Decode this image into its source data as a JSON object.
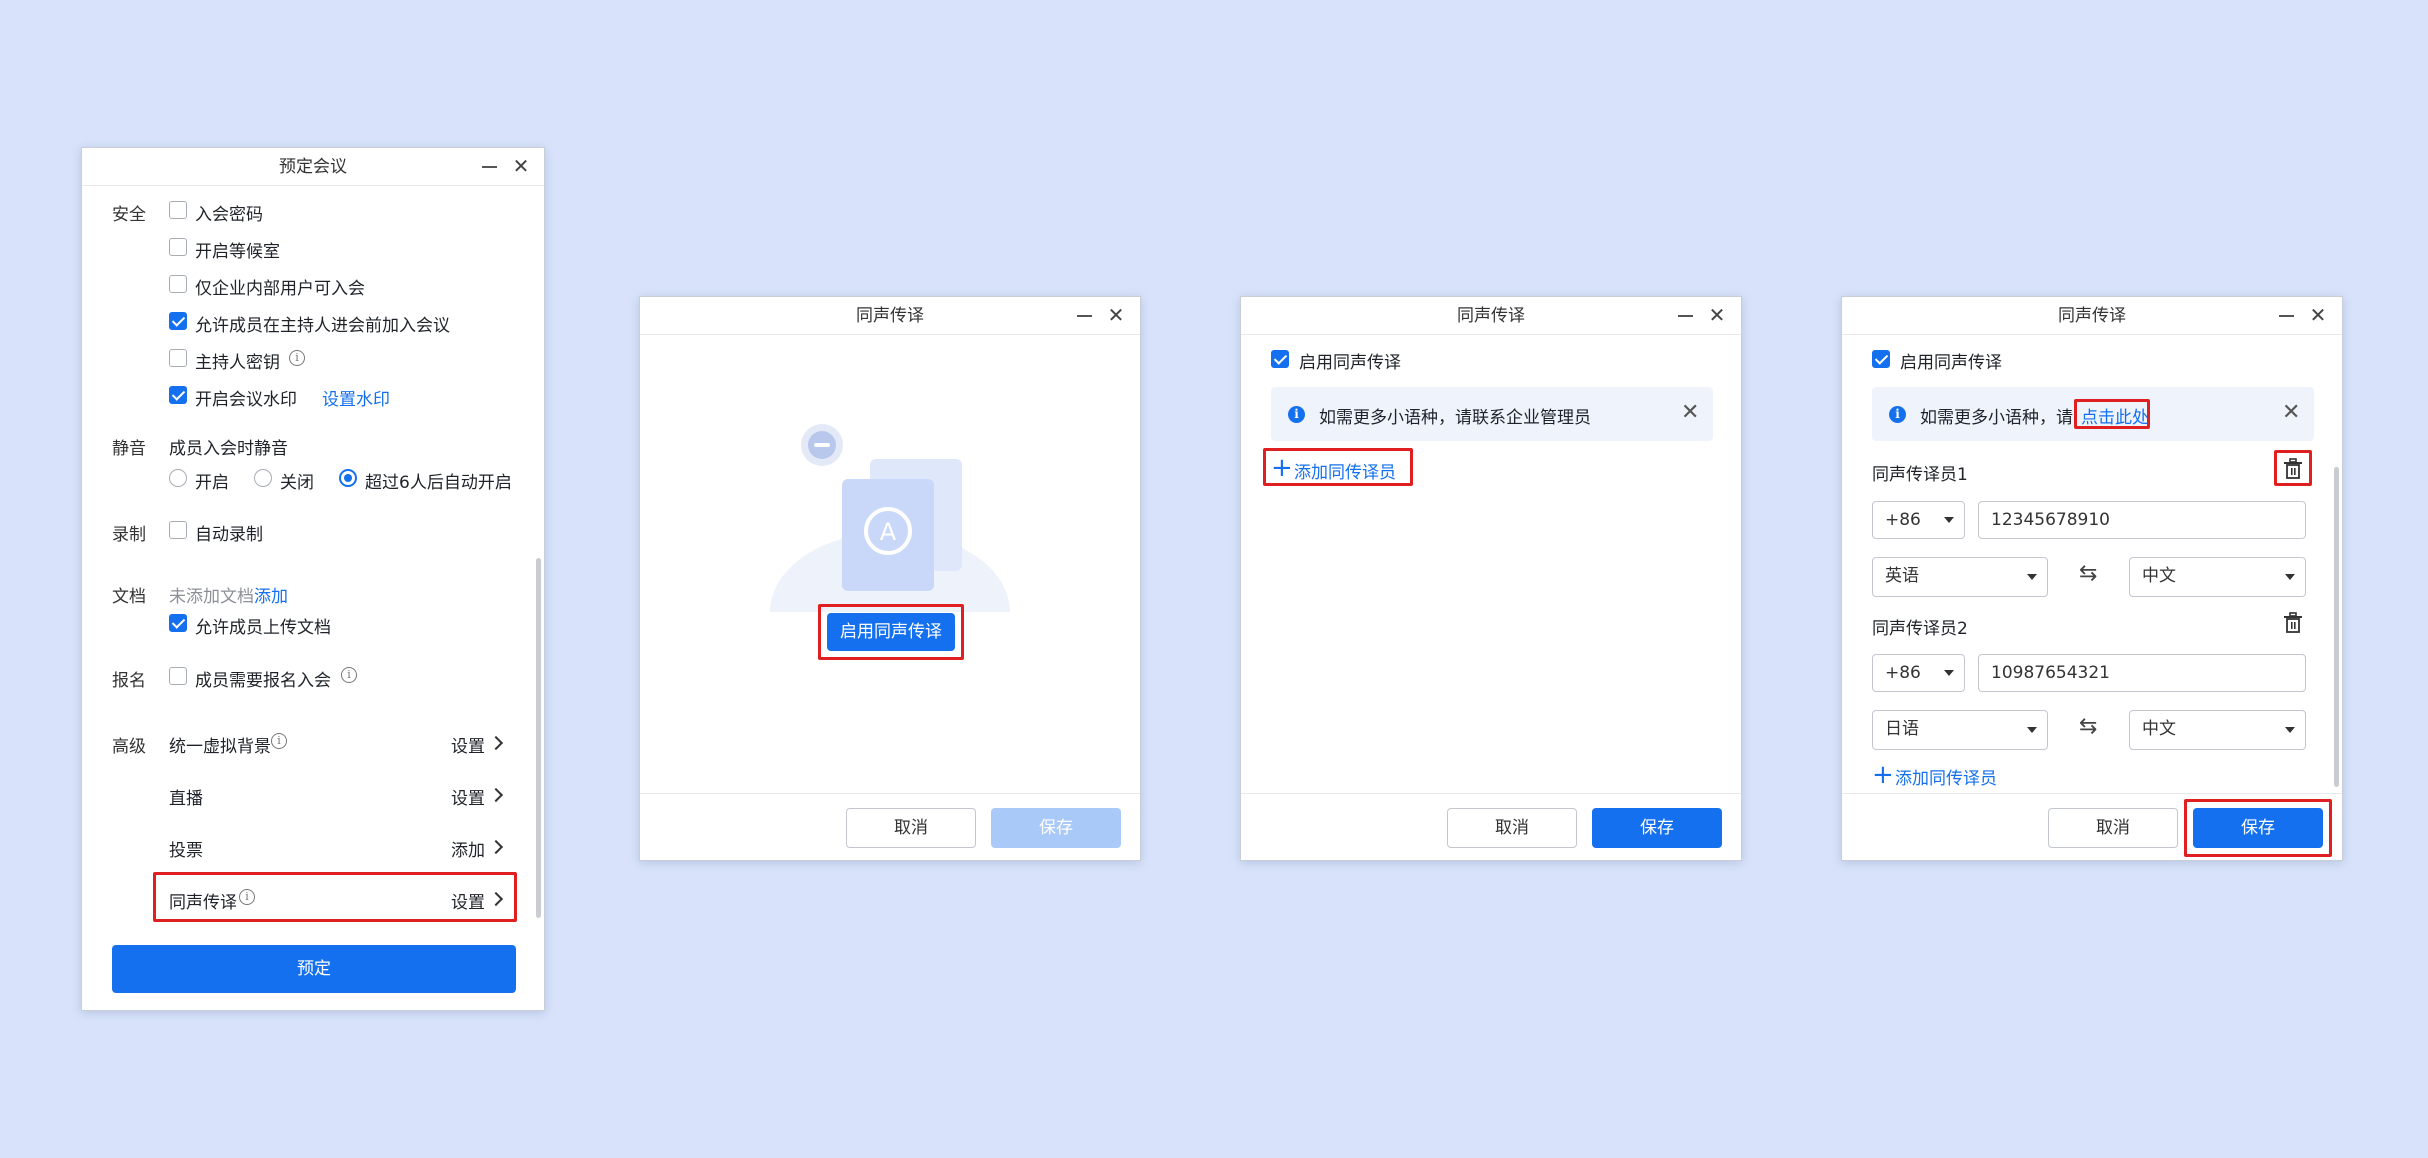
{
  "colors": {
    "background": "#d8e3fb",
    "accent": "#1570ef",
    "highlight": "#e02020",
    "disabled": "#a9c9f8"
  },
  "schedule": {
    "title": "预定会议",
    "security": {
      "label": "安全",
      "items": [
        {
          "label": "入会密码",
          "checked": false
        },
        {
          "label": "开启等候室",
          "checked": false
        },
        {
          "label": "仅企业内部用户可入会",
          "checked": false
        },
        {
          "label": "允许成员在主持人进会前加入会议",
          "checked": true
        },
        {
          "label": "主持人密钥",
          "checked": false
        },
        {
          "label": "开启会议水印",
          "checked": true
        }
      ],
      "watermark_link": "设置水印"
    },
    "mute": {
      "label": "静音",
      "sublabel": "成员入会时静音",
      "options": [
        "开启",
        "关闭",
        "超过6人后自动开启"
      ],
      "selected": "超过6人后自动开启"
    },
    "record": {
      "label": "录制",
      "item": "自动录制"
    },
    "docs": {
      "label": "文档",
      "none": "未添加文档",
      "add": "添加",
      "allow_upload": "允许成员上传文档"
    },
    "signup": {
      "label": "报名",
      "item": "成员需要报名入会"
    },
    "advanced": {
      "label": "高级",
      "rows": [
        {
          "label": "统一虚拟背景",
          "action": "设置"
        },
        {
          "label": "直播",
          "action": "设置"
        },
        {
          "label": "投票",
          "action": "添加"
        },
        {
          "label": "同声传译",
          "action": "设置"
        }
      ]
    },
    "submit": "预定"
  },
  "interp_empty": {
    "title": "同声传译",
    "enable_button": "启用同声传译",
    "cancel": "取消",
    "save": "保存"
  },
  "interp_enabled": {
    "title": "同声传译",
    "enable_label": "启用同声传译",
    "notice": "如需更多小语种，请联系企业管理员",
    "add": "添加同传译员",
    "cancel": "取消",
    "save": "保存"
  },
  "interp_filled": {
    "title": "同声传译",
    "enable_label": "启用同声传译",
    "notice_prefix": "如需更多小语种，请",
    "notice_link": "点击此处",
    "interpreters": [
      {
        "label": "同声传译员1",
        "code": "+86",
        "phone": "12345678910",
        "from": "英语",
        "to": "中文"
      },
      {
        "label": "同声传译员2",
        "code": "+86",
        "phone": "10987654321",
        "from": "日语",
        "to": "中文"
      }
    ],
    "add": "添加同传译员",
    "cancel": "取消",
    "save": "保存"
  },
  "icons": {
    "minimize": "minimize-icon",
    "close": "close-icon",
    "swap": "⇆",
    "close_glyph": "✕",
    "info": "i",
    "plus": "+"
  }
}
